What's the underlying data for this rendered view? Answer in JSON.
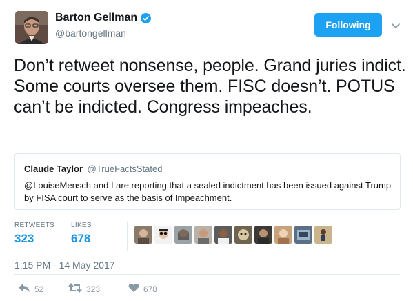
{
  "author": {
    "name": "Barton Gellman",
    "handle": "@bartongellman",
    "verified": true
  },
  "follow_button": {
    "label": "Following"
  },
  "tweet": {
    "text": "Don’t retweet nonsense, people. Grand juries indict. Some courts oversee them. FISC doesn’t. POTUS can’t be indicted. Congress impeaches."
  },
  "quoted_tweet": {
    "name": "Claude Taylor",
    "handle": "@TrueFactsStated",
    "text": "@LouiseMensch and I are reporting that a sealed indictment has been issued against Trump by FISA court to serve as the basis of Impeachment."
  },
  "stats": {
    "retweets_label": "RETWEETS",
    "retweets_value": "323",
    "likes_label": "LIKES",
    "likes_value": "678"
  },
  "likers": [
    "liker-1",
    "liker-2",
    "liker-3",
    "liker-4",
    "liker-5",
    "liker-6",
    "liker-7",
    "liker-8",
    "liker-9",
    "liker-10"
  ],
  "timestamp": "1:15 PM - 14 May 2017",
  "actions": {
    "reply_count": "52",
    "retweet_count": "323",
    "like_count": "678"
  },
  "colors": {
    "accent": "#1da1f2",
    "count_blue": "#1b95e0",
    "muted": "#657786",
    "border": "#e1e8ed"
  }
}
